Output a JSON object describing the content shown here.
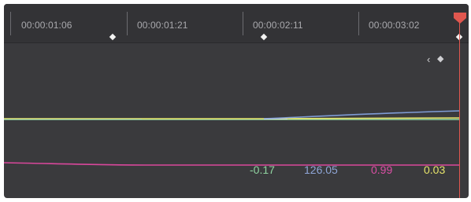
{
  "timeline": {
    "timecodes": [
      "00:00:01:06",
      "00:00:01:21",
      "00:00:02:11",
      "00:00:03:02"
    ]
  },
  "keyframe_nav": {
    "prev_icon": "chevron-left-icon",
    "diamond_icon": "keyframe-diamond-icon"
  },
  "curves": [
    {
      "id": "curve-blue",
      "color": "#7f9cd6"
    },
    {
      "id": "curve-yellow",
      "color": "#e6e36a"
    },
    {
      "id": "curve-green",
      "color": "#8fd3a0"
    },
    {
      "id": "curve-magenta",
      "color": "#d9479c"
    }
  ],
  "readouts": [
    {
      "value": "-0.17",
      "color": "#8fd3a0"
    },
    {
      "value": "126.05",
      "color": "#8fa6d8"
    },
    {
      "value": "0.99",
      "color": "#d94fa4"
    },
    {
      "value": "0.03",
      "color": "#e6e36a"
    }
  ],
  "playhead": {
    "color": "#e0574f"
  }
}
